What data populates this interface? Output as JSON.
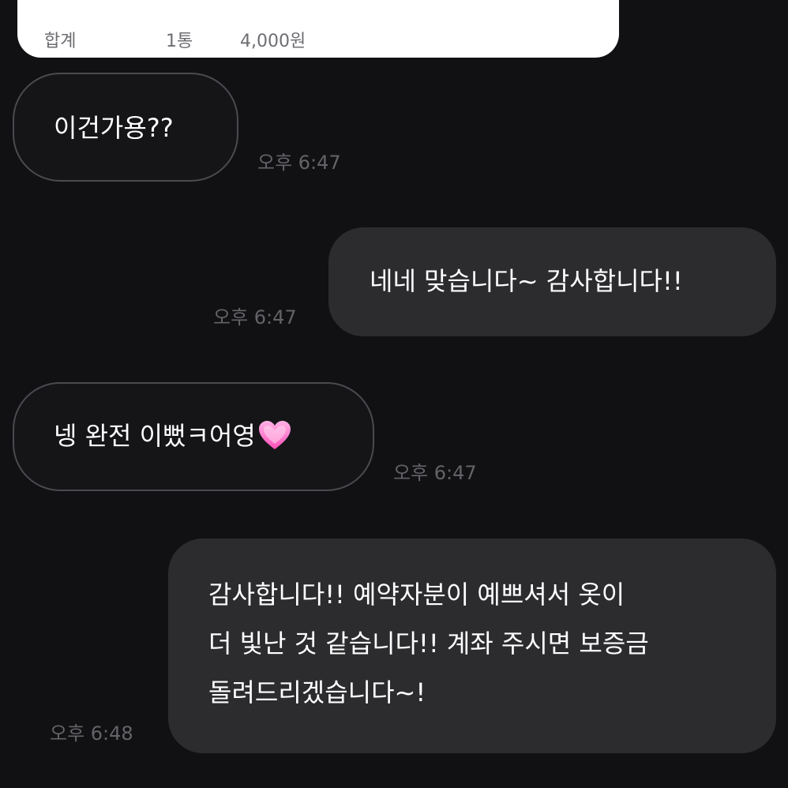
{
  "receipt": {
    "label": "합계",
    "quantity": "1통",
    "amount": "4,000원"
  },
  "messages": [
    {
      "side": "received",
      "text": "이건가용??",
      "time": "오후 6:47"
    },
    {
      "side": "sent",
      "text": "네네 맞습니다~ 감사합니다!!",
      "time": "오후 6:47"
    },
    {
      "side": "received",
      "text": "넹 완전 이뻤ㅋ어영",
      "emoji": "heart-icon",
      "time": "오후 6:47"
    },
    {
      "side": "sent",
      "lines": [
        "감사합니다!! 예약자분이 예쁘셔서 옷이",
        "더 빛난 것 같습니다!! 계좌 주시면 보증금",
        "돌려드리겠습니다~!"
      ],
      "time": "오후 6:48"
    }
  ],
  "colors": {
    "background": "#111114",
    "received_bubble": "#151518",
    "received_border": "#4a4a4f",
    "sent_bubble": "#2c2c2f",
    "timestamp": "#646468",
    "heart": "#ff6fc8"
  }
}
